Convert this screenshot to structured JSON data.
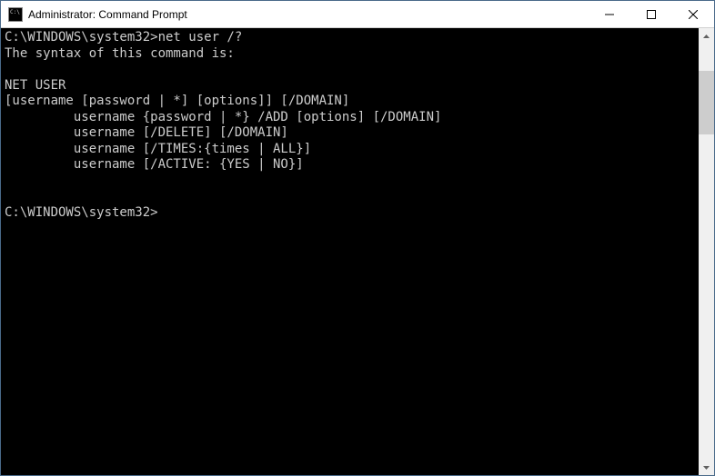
{
  "window": {
    "title": "Administrator: Command Prompt"
  },
  "console": {
    "prompt1": "C:\\WINDOWS\\system32>",
    "command1": "net user /?",
    "output_line1": "The syntax of this command is:",
    "blank1": "",
    "output_line2": "NET USER",
    "output_line3": "[username [password | *] [options]] [/DOMAIN]",
    "output_line4": "         username {password | *} /ADD [options] [/DOMAIN]",
    "output_line5": "         username [/DELETE] [/DOMAIN]",
    "output_line6": "         username [/TIMES:{times | ALL}]",
    "output_line7": "         username [/ACTIVE: {YES | NO}]",
    "blank2": "",
    "blank3": "",
    "prompt2": "C:\\WINDOWS\\system32>"
  }
}
